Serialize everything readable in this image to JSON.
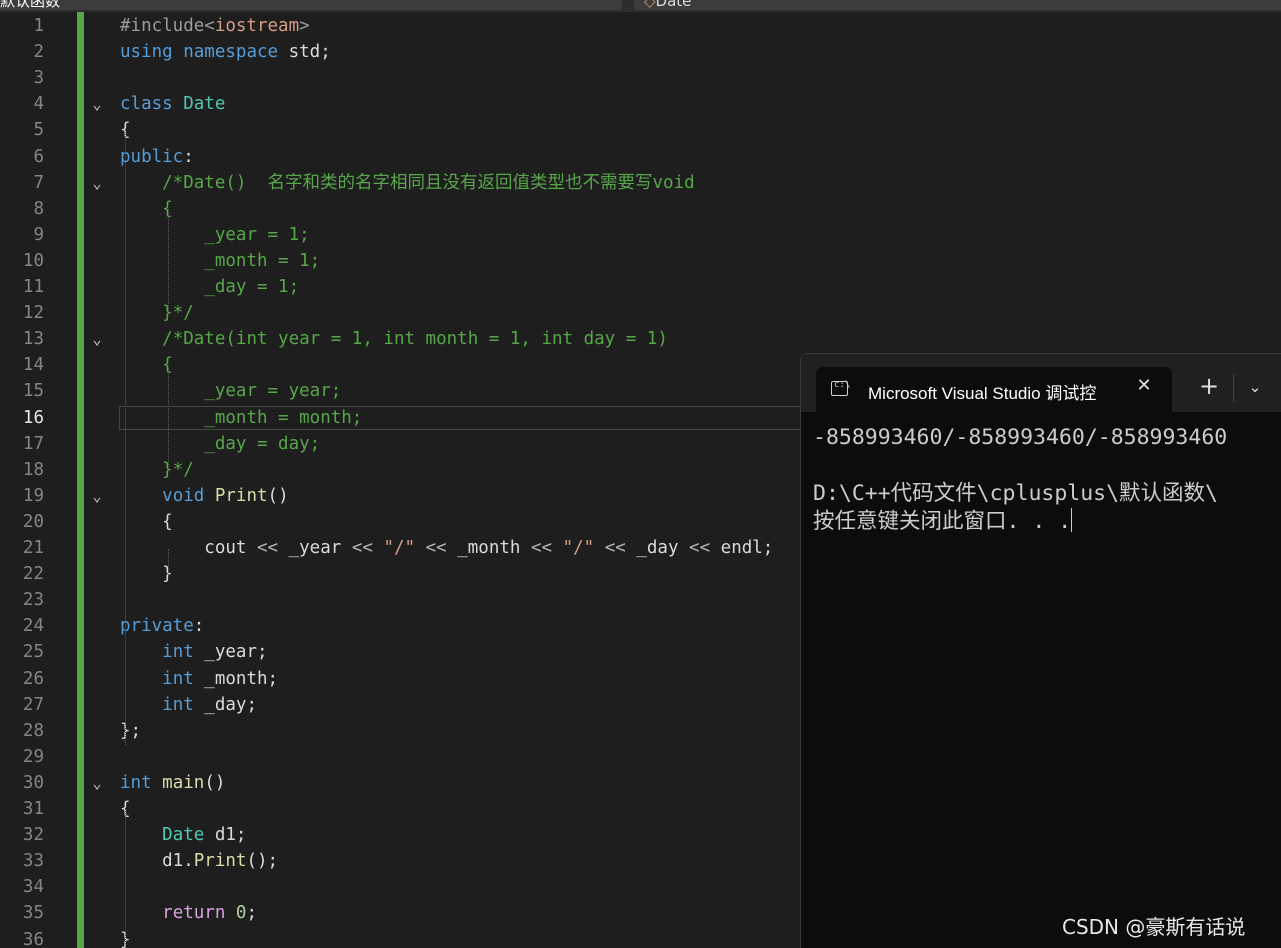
{
  "tabs": {
    "left_label": "默认函数",
    "right_label": "Date",
    "right_icon": "class-icon"
  },
  "editor": {
    "current_line": "16",
    "lines": [
      {
        "n": "1",
        "fold": "",
        "tokens": [
          [
            "pp",
            "#include<"
          ],
          [
            "str",
            "iostream"
          ],
          [
            "pp",
            ">"
          ]
        ]
      },
      {
        "n": "2",
        "fold": "",
        "tokens": [
          [
            "k",
            "using"
          ],
          [
            "v",
            " "
          ],
          [
            "k",
            "namespace"
          ],
          [
            "v",
            " std;"
          ]
        ]
      },
      {
        "n": "3",
        "fold": "",
        "tokens": []
      },
      {
        "n": "4",
        "fold": "⌄",
        "tokens": [
          [
            "k",
            "class"
          ],
          [
            "v",
            " "
          ],
          [
            "ty",
            "Date"
          ]
        ]
      },
      {
        "n": "5",
        "fold": "",
        "tokens": [
          [
            "v",
            "{"
          ]
        ]
      },
      {
        "n": "6",
        "fold": "",
        "tokens": [
          [
            "k",
            "public"
          ],
          [
            "v",
            ":"
          ]
        ]
      },
      {
        "n": "7",
        "fold": "⌄",
        "tokens": [
          [
            "v",
            "    "
          ],
          [
            "c",
            "/*Date()  名字和类的名字相同且没有返回值类型也不需要写void"
          ]
        ]
      },
      {
        "n": "8",
        "fold": "",
        "tokens": [
          [
            "v",
            "    "
          ],
          [
            "c",
            "{"
          ]
        ]
      },
      {
        "n": "9",
        "fold": "",
        "tokens": [
          [
            "v",
            "        "
          ],
          [
            "c",
            "_year = 1;"
          ]
        ]
      },
      {
        "n": "10",
        "fold": "",
        "tokens": [
          [
            "v",
            "        "
          ],
          [
            "c",
            "_month = 1;"
          ]
        ]
      },
      {
        "n": "11",
        "fold": "",
        "tokens": [
          [
            "v",
            "        "
          ],
          [
            "c",
            "_day = 1;"
          ]
        ]
      },
      {
        "n": "12",
        "fold": "",
        "tokens": [
          [
            "v",
            "    "
          ],
          [
            "c",
            "}*/"
          ]
        ]
      },
      {
        "n": "13",
        "fold": "⌄",
        "tokens": [
          [
            "v",
            "    "
          ],
          [
            "c",
            "/*Date(int year = 1, int month = 1, int day = 1)"
          ]
        ]
      },
      {
        "n": "14",
        "fold": "",
        "tokens": [
          [
            "v",
            "    "
          ],
          [
            "c",
            "{"
          ]
        ]
      },
      {
        "n": "15",
        "fold": "",
        "tokens": [
          [
            "v",
            "        "
          ],
          [
            "c",
            "_year = year;"
          ]
        ]
      },
      {
        "n": "16",
        "fold": "",
        "tokens": [
          [
            "v",
            "        "
          ],
          [
            "c",
            "_month = month;"
          ]
        ]
      },
      {
        "n": "17",
        "fold": "",
        "tokens": [
          [
            "v",
            "        "
          ],
          [
            "c",
            "_day = day;"
          ]
        ]
      },
      {
        "n": "18",
        "fold": "",
        "tokens": [
          [
            "v",
            "    "
          ],
          [
            "c",
            "}*/"
          ]
        ]
      },
      {
        "n": "19",
        "fold": "⌄",
        "tokens": [
          [
            "v",
            "    "
          ],
          [
            "k",
            "void"
          ],
          [
            "v",
            " "
          ],
          [
            "f",
            "Print"
          ],
          [
            "v",
            "()"
          ]
        ]
      },
      {
        "n": "20",
        "fold": "",
        "tokens": [
          [
            "v",
            "    {"
          ]
        ]
      },
      {
        "n": "21",
        "fold": "",
        "tokens": [
          [
            "v",
            "        cout "
          ],
          [
            "op",
            "<<"
          ],
          [
            "v",
            " _year "
          ],
          [
            "op",
            "<<"
          ],
          [
            "v",
            " "
          ],
          [
            "str",
            "\"/\""
          ],
          [
            "v",
            " "
          ],
          [
            "op",
            "<<"
          ],
          [
            "v",
            " _month "
          ],
          [
            "op",
            "<<"
          ],
          [
            "v",
            " "
          ],
          [
            "str",
            "\"/\""
          ],
          [
            "v",
            " "
          ],
          [
            "op",
            "<<"
          ],
          [
            "v",
            " _day "
          ],
          [
            "op",
            "<<"
          ],
          [
            "v",
            " endl;"
          ]
        ]
      },
      {
        "n": "22",
        "fold": "",
        "tokens": [
          [
            "v",
            "    }"
          ]
        ]
      },
      {
        "n": "23",
        "fold": "",
        "tokens": []
      },
      {
        "n": "24",
        "fold": "",
        "tokens": [
          [
            "k",
            "private"
          ],
          [
            "v",
            ":"
          ]
        ]
      },
      {
        "n": "25",
        "fold": "",
        "tokens": [
          [
            "v",
            "    "
          ],
          [
            "k",
            "int"
          ],
          [
            "v",
            " _year;"
          ]
        ]
      },
      {
        "n": "26",
        "fold": "",
        "tokens": [
          [
            "v",
            "    "
          ],
          [
            "k",
            "int"
          ],
          [
            "v",
            " _month;"
          ]
        ]
      },
      {
        "n": "27",
        "fold": "",
        "tokens": [
          [
            "v",
            "    "
          ],
          [
            "k",
            "int"
          ],
          [
            "v",
            " _day;"
          ]
        ]
      },
      {
        "n": "28",
        "fold": "",
        "tokens": [
          [
            "v",
            "};"
          ]
        ]
      },
      {
        "n": "29",
        "fold": "",
        "tokens": []
      },
      {
        "n": "30",
        "fold": "⌄",
        "tokens": [
          [
            "k",
            "int"
          ],
          [
            "v",
            " "
          ],
          [
            "f",
            "main"
          ],
          [
            "v",
            "()"
          ]
        ]
      },
      {
        "n": "31",
        "fold": "",
        "tokens": [
          [
            "v",
            "{"
          ]
        ]
      },
      {
        "n": "32",
        "fold": "",
        "tokens": [
          [
            "v",
            "    "
          ],
          [
            "ty",
            "Date"
          ],
          [
            "v",
            " d1;"
          ]
        ]
      },
      {
        "n": "33",
        "fold": "",
        "tokens": [
          [
            "v",
            "    d1."
          ],
          [
            "f",
            "Print"
          ],
          [
            "v",
            "();"
          ]
        ]
      },
      {
        "n": "34",
        "fold": "",
        "tokens": []
      },
      {
        "n": "35",
        "fold": "",
        "tokens": [
          [
            "v",
            "    "
          ],
          [
            "ctl",
            "return"
          ],
          [
            "v",
            " "
          ],
          [
            "num",
            "0"
          ],
          [
            "v",
            ";"
          ]
        ]
      },
      {
        "n": "36",
        "fold": "",
        "tokens": [
          [
            "v",
            "}"
          ]
        ]
      }
    ]
  },
  "console": {
    "tab_title": "Microsoft Visual Studio 调试控",
    "icon": "terminal-icon",
    "close_glyph": "✕",
    "new_tab_glyph": "+",
    "dropdown_glyph": "⌄",
    "output": [
      "-858993460/-858993460/-858993460",
      "",
      "D:\\C++代码文件\\cplusplus\\默认函数\\",
      "按任意键关闭此窗口. . ."
    ]
  },
  "watermark": "CSDN @豪斯有话说"
}
